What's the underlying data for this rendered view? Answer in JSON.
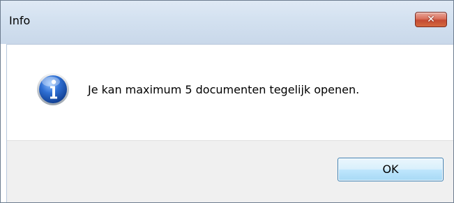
{
  "window": {
    "title": "Info",
    "close_label": "✕"
  },
  "dialog": {
    "icon": "information-icon",
    "message": "Je kan maximum 5 documenten tegelijk openen.",
    "ok_label": "OK"
  },
  "colors": {
    "titlebar": "#d3e1f0",
    "close_button": "#c44a33",
    "footer": "#f0f0f0",
    "ok_button_border": "#3c7fb1",
    "info_icon": "#1f5fbf"
  }
}
